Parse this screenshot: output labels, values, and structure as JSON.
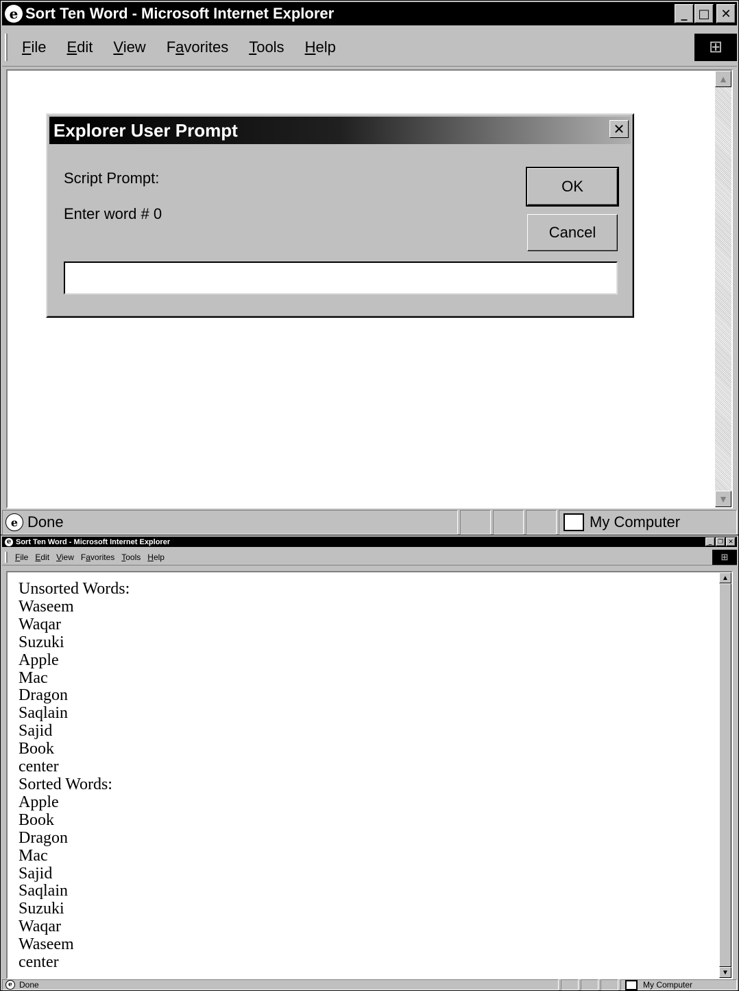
{
  "top_window": {
    "title": "Sort Ten Word - Microsoft Internet Explorer",
    "menu": [
      {
        "pre": "",
        "ul": "F",
        "post": "ile"
      },
      {
        "pre": "",
        "ul": "E",
        "post": "dit"
      },
      {
        "pre": "",
        "ul": "V",
        "post": "iew"
      },
      {
        "pre": "F",
        "ul": "a",
        "post": "vorites"
      },
      {
        "pre": "",
        "ul": "T",
        "post": "ools"
      },
      {
        "pre": "",
        "ul": "H",
        "post": "elp"
      }
    ],
    "status_text": "Done",
    "zone_text": "My Computer",
    "dialog": {
      "title": "Explorer User Prompt",
      "label1": "Script Prompt:",
      "label2": "Enter word # 0",
      "ok_label": "OK",
      "cancel_label": "Cancel",
      "input_value": ""
    }
  },
  "bottom_window": {
    "title": "Sort Ten Word - Microsoft Internet Explorer",
    "menu": [
      {
        "pre": "",
        "ul": "F",
        "post": "ile"
      },
      {
        "pre": "",
        "ul": "E",
        "post": "dit"
      },
      {
        "pre": "",
        "ul": "V",
        "post": "iew"
      },
      {
        "pre": "F",
        "ul": "a",
        "post": "vorites"
      },
      {
        "pre": "",
        "ul": "T",
        "post": "ools"
      },
      {
        "pre": "",
        "ul": "H",
        "post": "elp"
      }
    ],
    "status_text": "Done",
    "zone_text": "My Computer",
    "unsorted_heading": "Unsorted Words:",
    "unsorted": [
      "Waseem",
      "Waqar",
      "Suzuki",
      "Apple",
      "Mac",
      "Dragon",
      "Saqlain",
      "Sajid",
      "Book",
      "center"
    ],
    "sorted_heading": "Sorted Words:",
    "sorted": [
      "Apple",
      "Book",
      "Dragon",
      "Mac",
      "Sajid",
      "Saqlain",
      "Suzuki",
      "Waqar",
      "Waseem",
      "center"
    ]
  },
  "icons": {
    "ie": "e",
    "minimize": "_",
    "maximize": "□",
    "restore": "❐",
    "close": "✕",
    "scroll_up": "▲",
    "scroll_down": "▼",
    "windows_logo": "⊞"
  }
}
